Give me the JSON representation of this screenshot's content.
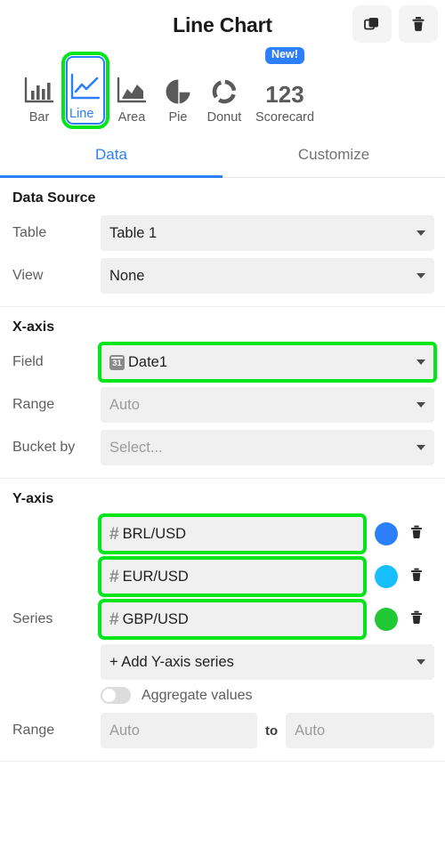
{
  "header": {
    "title": "Line Chart",
    "duplicate_label": "duplicate-icon",
    "delete_label": "trash-icon"
  },
  "chart_types": [
    {
      "label": "Bar",
      "icon": "bar-chart-icon",
      "selected": false,
      "badge": ""
    },
    {
      "label": "Line",
      "icon": "line-chart-icon",
      "selected": true,
      "badge": ""
    },
    {
      "label": "Area",
      "icon": "area-chart-icon",
      "selected": false,
      "badge": ""
    },
    {
      "label": "Pie",
      "icon": "pie-chart-icon",
      "selected": false,
      "badge": ""
    },
    {
      "label": "Donut",
      "icon": "donut-chart-icon",
      "selected": false,
      "badge": ""
    },
    {
      "label": "Scorecard",
      "icon": "scorecard-icon",
      "selected": false,
      "badge": "New!",
      "glyph_text": "123"
    }
  ],
  "tabs": [
    {
      "label": "Data",
      "active": true
    },
    {
      "label": "Customize",
      "active": false
    }
  ],
  "data_source": {
    "title": "Data Source",
    "table": {
      "label": "Table",
      "value": "Table 1"
    },
    "view": {
      "label": "View",
      "value": "None"
    }
  },
  "x_axis": {
    "title": "X-axis",
    "field": {
      "label": "Field",
      "value": "Date1",
      "field_icon": "calendar-icon",
      "calendar_day": "31",
      "highlighted": true
    },
    "range": {
      "label": "Range",
      "value": "Auto",
      "muted": true
    },
    "bucket_by": {
      "label": "Bucket by",
      "value": "Select...",
      "muted": true
    }
  },
  "y_axis": {
    "title": "Y-axis",
    "series_label": "Series",
    "series": [
      {
        "value": "BRL/USD",
        "field_icon": "number-icon",
        "color": "#2d7ff9",
        "highlighted": true
      },
      {
        "value": "EUR/USD",
        "field_icon": "number-icon",
        "color": "#18bfff",
        "highlighted": true
      },
      {
        "value": "GBP/USD",
        "field_icon": "number-icon",
        "color": "#20c933",
        "highlighted": true
      }
    ],
    "add_series_label": "+ Add Y-axis series",
    "aggregate": {
      "label": "Aggregate values",
      "on": false
    },
    "range": {
      "label": "Range",
      "from": "Auto",
      "to_label": "to",
      "to": "Auto"
    }
  },
  "colors": {
    "accent": "#2d7ff9",
    "highlight": "#00e61a",
    "control_bg": "#f0f0f0",
    "muted_text": "#9b9b9b"
  }
}
